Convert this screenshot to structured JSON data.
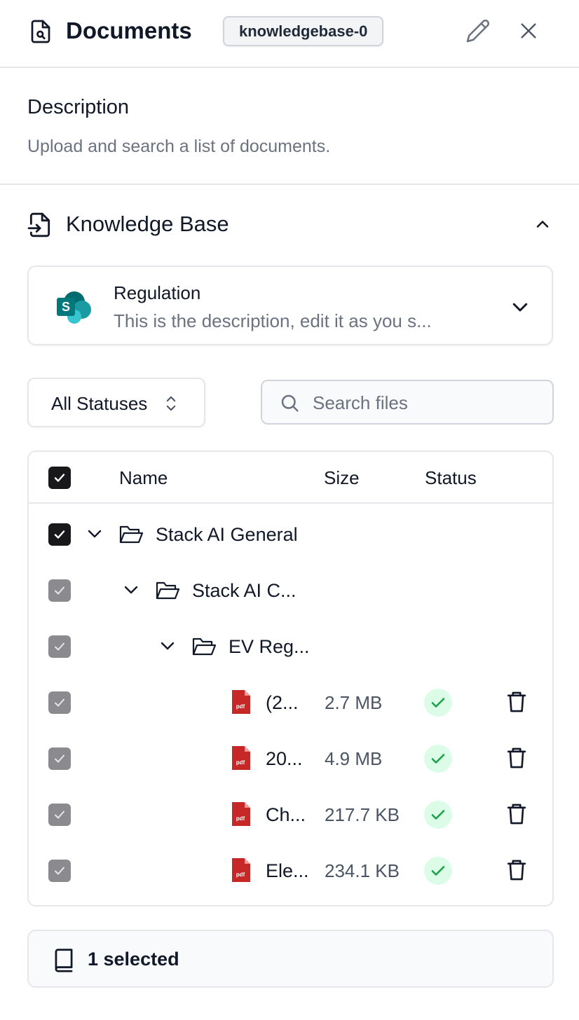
{
  "header": {
    "title": "Documents",
    "badge": "knowledgebase-0",
    "icons": {
      "document": "file-search-icon",
      "edit": "pencil-icon",
      "close": "close-icon"
    }
  },
  "description": {
    "label": "Description",
    "text": "Upload and search a list of documents."
  },
  "knowledge_base": {
    "title": "Knowledge Base",
    "icon": "file-import-icon",
    "collapse_icon": "chevron-up-icon",
    "source": {
      "name": "Regulation",
      "description": "This is the description, edit it as you s...",
      "logo": "sharepoint-logo",
      "expand_icon": "chevron-down-icon"
    }
  },
  "filters": {
    "status_select": "All Statuses",
    "search_placeholder": "Search files"
  },
  "table": {
    "columns": {
      "name": "Name",
      "size": "Size",
      "status": "Status"
    },
    "folders": [
      {
        "name": "Stack AI General",
        "checkbox": "checked"
      },
      {
        "name": "Stack AI C...",
        "checkbox": "checked-inherited"
      },
      {
        "name": "EV Reg...",
        "checkbox": "checked-inherited"
      }
    ],
    "files": [
      {
        "name": "(2...",
        "size": "2.7 MB",
        "type": "pdf",
        "status": "ready"
      },
      {
        "name": "20...",
        "size": "4.9 MB",
        "type": "pdf",
        "status": "ready"
      },
      {
        "name": "Ch...",
        "size": "217.7 KB",
        "type": "pdf",
        "status": "ready"
      },
      {
        "name": "Ele...",
        "size": "234.1 KB",
        "type": "pdf",
        "status": "ready"
      }
    ],
    "pdf_badge": "pdf"
  },
  "footer": {
    "selected_text": "1 selected",
    "icon": "book-icon"
  },
  "colors": {
    "checkbox_dark": "#18181b",
    "checkbox_inherited": "#8b8b8f",
    "success_bg": "#dcfce7",
    "success_check": "#16a34a",
    "pdf_red": "#c62828",
    "border": "#e5e7eb",
    "muted_text": "#6b7280"
  }
}
